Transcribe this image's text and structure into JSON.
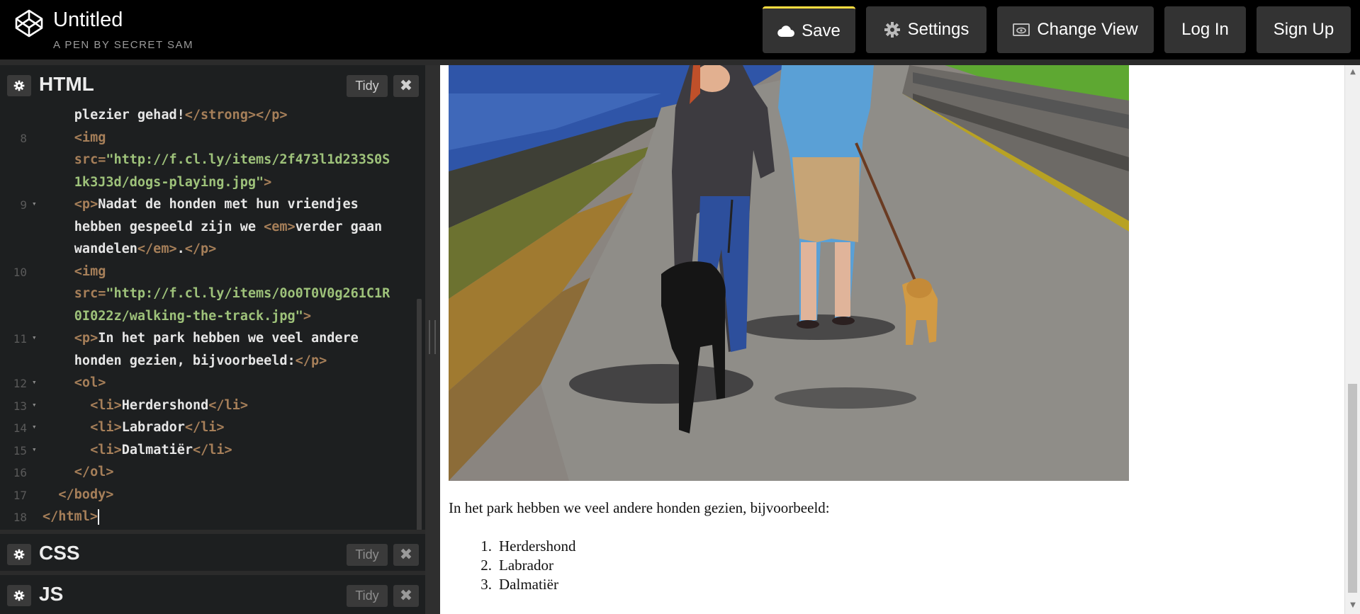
{
  "header": {
    "title": "Untitled",
    "subtitle": "A PEN BY SECRET SAM",
    "buttons": {
      "save": "Save",
      "settings": "Settings",
      "change_view": "Change View",
      "log_in": "Log In",
      "sign_up": "Sign Up"
    },
    "accent_color": "#ffdd40"
  },
  "editors": {
    "html": {
      "label": "HTML",
      "tidy": "Tidy"
    },
    "css": {
      "label": "CSS",
      "tidy": "Tidy"
    },
    "js": {
      "label": "JS",
      "tidy": "Tidy"
    }
  },
  "code_lines": [
    {
      "num": "",
      "indent": 4,
      "parts": [
        [
          "w",
          "plezier gehad!"
        ],
        [
          "t",
          "</strong></p>"
        ]
      ]
    },
    {
      "num": "8",
      "fold": false,
      "indent": 4,
      "parts": [
        [
          "t",
          "<img"
        ]
      ]
    },
    {
      "num": "",
      "indent": 4,
      "parts": [
        [
          "t",
          "src="
        ],
        [
          "s",
          "\"http://f.cl.ly/items/2f473l1d233S0S"
        ]
      ]
    },
    {
      "num": "",
      "indent": 4,
      "parts": [
        [
          "s",
          "1k3J3d/dogs-playing.jpg\""
        ],
        [
          "t",
          ">"
        ]
      ]
    },
    {
      "num": "9",
      "fold": true,
      "indent": 4,
      "parts": [
        [
          "t",
          "<p>"
        ],
        [
          "w",
          "Nadat de honden met hun vriendjes"
        ]
      ]
    },
    {
      "num": "",
      "indent": 4,
      "parts": [
        [
          "w",
          "hebben gespeeld zijn we "
        ],
        [
          "t",
          "<em>"
        ],
        [
          "w",
          "verder gaan"
        ]
      ]
    },
    {
      "num": "",
      "indent": 4,
      "parts": [
        [
          "w",
          "wandelen"
        ],
        [
          "t",
          "</em>"
        ],
        [
          "w",
          "."
        ],
        [
          "t",
          "</p>"
        ]
      ]
    },
    {
      "num": "10",
      "fold": false,
      "indent": 4,
      "parts": [
        [
          "t",
          "<img"
        ]
      ]
    },
    {
      "num": "",
      "indent": 4,
      "parts": [
        [
          "t",
          "src="
        ],
        [
          "s",
          "\"http://f.cl.ly/items/0o0T0V0g261C1R"
        ]
      ]
    },
    {
      "num": "",
      "indent": 4,
      "parts": [
        [
          "s",
          "0I022z/walking-the-track.jpg\""
        ],
        [
          "t",
          ">"
        ]
      ]
    },
    {
      "num": "11",
      "fold": true,
      "indent": 4,
      "parts": [
        [
          "t",
          "<p>"
        ],
        [
          "w",
          "In het park hebben we veel andere"
        ]
      ]
    },
    {
      "num": "",
      "indent": 4,
      "parts": [
        [
          "w",
          "honden gezien, bijvoorbeeld:"
        ],
        [
          "t",
          "</p>"
        ]
      ]
    },
    {
      "num": "12",
      "fold": true,
      "indent": 4,
      "parts": [
        [
          "t",
          "<ol>"
        ]
      ]
    },
    {
      "num": "13",
      "fold": true,
      "indent": 6,
      "parts": [
        [
          "t",
          "<li>"
        ],
        [
          "w",
          "Herdershond"
        ],
        [
          "t",
          "</li>"
        ]
      ]
    },
    {
      "num": "14",
      "fold": true,
      "indent": 6,
      "parts": [
        [
          "t",
          "<li>"
        ],
        [
          "w",
          "Labrador"
        ],
        [
          "t",
          "</li>"
        ]
      ]
    },
    {
      "num": "15",
      "fold": true,
      "indent": 6,
      "parts": [
        [
          "t",
          "<li>"
        ],
        [
          "w",
          "Dalmatiër"
        ],
        [
          "t",
          "</li>"
        ]
      ]
    },
    {
      "num": "16",
      "fold": false,
      "indent": 4,
      "parts": [
        [
          "t",
          "</ol>"
        ]
      ]
    },
    {
      "num": "17",
      "fold": false,
      "indent": 2,
      "parts": [
        [
          "t",
          "</body>"
        ]
      ]
    },
    {
      "num": "18",
      "fold": false,
      "indent": 0,
      "parts": [
        [
          "t",
          "</html>"
        ]
      ],
      "caret": true
    }
  ],
  "preview": {
    "paragraph": "In het park hebben we veel andere honden gezien, bijvoorbeeld:",
    "list": [
      {
        "num": "1.",
        "text": "Herdershond"
      },
      {
        "num": "2.",
        "text": "Labrador"
      },
      {
        "num": "3.",
        "text": "Dalmatiër"
      }
    ]
  }
}
